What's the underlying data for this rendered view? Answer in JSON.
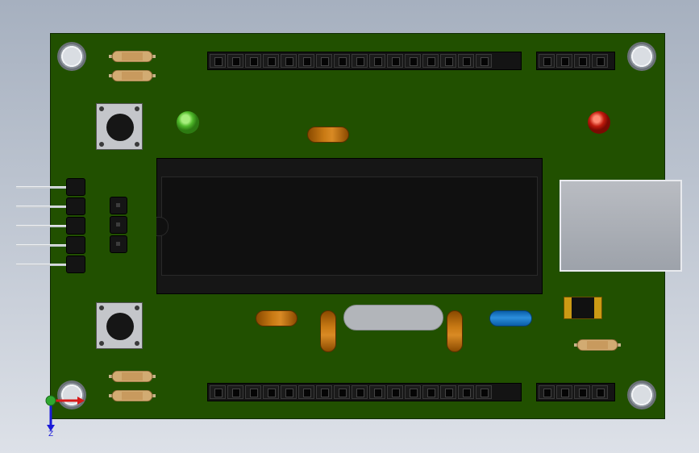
{
  "viewport": {
    "label": "pcb-3d-view"
  },
  "board": {
    "color": "#215000"
  },
  "header_top": {
    "pins_main": 16,
    "pins_aux": 4
  },
  "header_bottom": {
    "pins_main": 16,
    "pins_aux": 4
  },
  "leds": {
    "green": "#4fb82a",
    "red": "#c01a0c"
  },
  "triad": {
    "axis_z_label": "Z"
  },
  "icons": [
    "mounting-hole-icon",
    "tactile-button-icon",
    "led-icon",
    "resistor-icon",
    "capacitor-icon",
    "crystal-icon",
    "usb-connector-icon",
    "ic-chip-icon",
    "coordinate-triad-icon"
  ]
}
